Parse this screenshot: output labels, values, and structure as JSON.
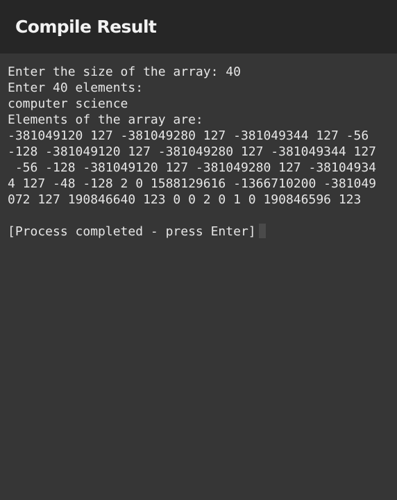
{
  "header": {
    "title": "Compile Result"
  },
  "terminal": {
    "lines": [
      "Enter the size of the array: 40",
      "Enter 40 elements:",
      "computer science",
      "Elements of the array are:",
      "-381049120 127 -381049280 127 -381049344 127 -56",
      "-128 -381049120 127 -381049280 127 -381049344 127",
      " -56 -128 -381049120 127 -381049280 127 -38104934",
      "4 127 -48 -128 2 0 1588129616 -1366710200 -381049",
      "072 127 190846640 123 0 0 2 0 1 0 190846596 123"
    ],
    "status": "[Process completed - press Enter]"
  },
  "colors": {
    "header_bg": "#262626",
    "terminal_bg": "#363636",
    "text": "#e6e6e6"
  }
}
